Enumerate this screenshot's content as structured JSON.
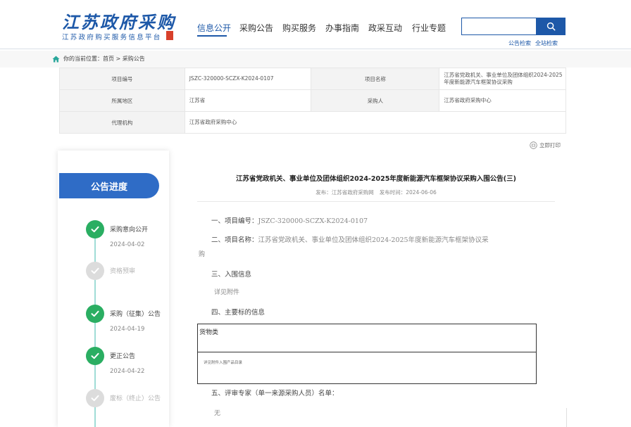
{
  "header": {
    "logo_text": "江苏政府采购",
    "logo_sub": "江苏政府购买服务信息平台"
  },
  "nav": {
    "items": [
      {
        "label": "信息公开",
        "active": true
      },
      {
        "label": "采购公告"
      },
      {
        "label": "购买服务"
      },
      {
        "label": "办事指南"
      },
      {
        "label": "政采互动"
      },
      {
        "label": "行业专题"
      }
    ]
  },
  "search": {
    "value": "",
    "placeholder": "",
    "links": [
      "公告检索",
      "全站检索"
    ],
    "button_icon": "search-icon"
  },
  "breadcrumb": {
    "icon": "home-icon",
    "prefix": "你的当前位置：",
    "path": "首页 > 采购公告"
  },
  "info_table": {
    "rows": [
      {
        "label1": "项目编号",
        "value1": "JSZC-320000-SCZX-K2024-0107",
        "label2": "项目名称",
        "value2": "江苏省党政机关、事业单位及团体组织2024-2025年度新能源汽车框架协议采购"
      },
      {
        "label1": "所属地区",
        "value1": "江苏省",
        "label2": "采购人",
        "value2": "江苏省政府采购中心"
      },
      {
        "label1": "代理机构",
        "value1": "江苏省政府采购中心"
      }
    ]
  },
  "print": {
    "label": "立即打印",
    "icon": "print-icon"
  },
  "sidebar": {
    "title": "公告进度",
    "steps": [
      {
        "label": "采购意向公开",
        "date": "2024-04-02",
        "status": "done"
      },
      {
        "label": "资格预审",
        "date": "",
        "status": "pending"
      },
      {
        "label": "采购（征集）公告",
        "date": "2024-04-19",
        "status": "done"
      },
      {
        "label": "更正公告",
        "date": "2024-04-22",
        "status": "done"
      },
      {
        "label": "废标（终止）公告",
        "date": "",
        "status": "pending"
      }
    ]
  },
  "announcement": {
    "title": "江苏省党政机关、事业单位及团体组织2024-2025年度新能源汽车框架协议采购入围公告(三)",
    "publisher": "发布：江苏省政府采购网",
    "publish_time": "发布时间：2024-06-06",
    "s1_label": "一、项目编号：",
    "s1_value": "JSZC-320000-SCZX-K2024-0107",
    "s2_label": "二、项目名称：",
    "s2_value": "江苏省党政机关、事业单位及团体组织2024-2025年度新能源汽车框架协议采",
    "s2_cont": "购",
    "s3_label": "三、入围信息",
    "s3_body": "详见附件",
    "s4_label": "四、主要标的信息",
    "lot_header": "货物类",
    "lot_body": "详见附件入围产品目录",
    "s5_label": "五、评审专家（单一来源采购人员）名单：",
    "s5_body": "无"
  }
}
